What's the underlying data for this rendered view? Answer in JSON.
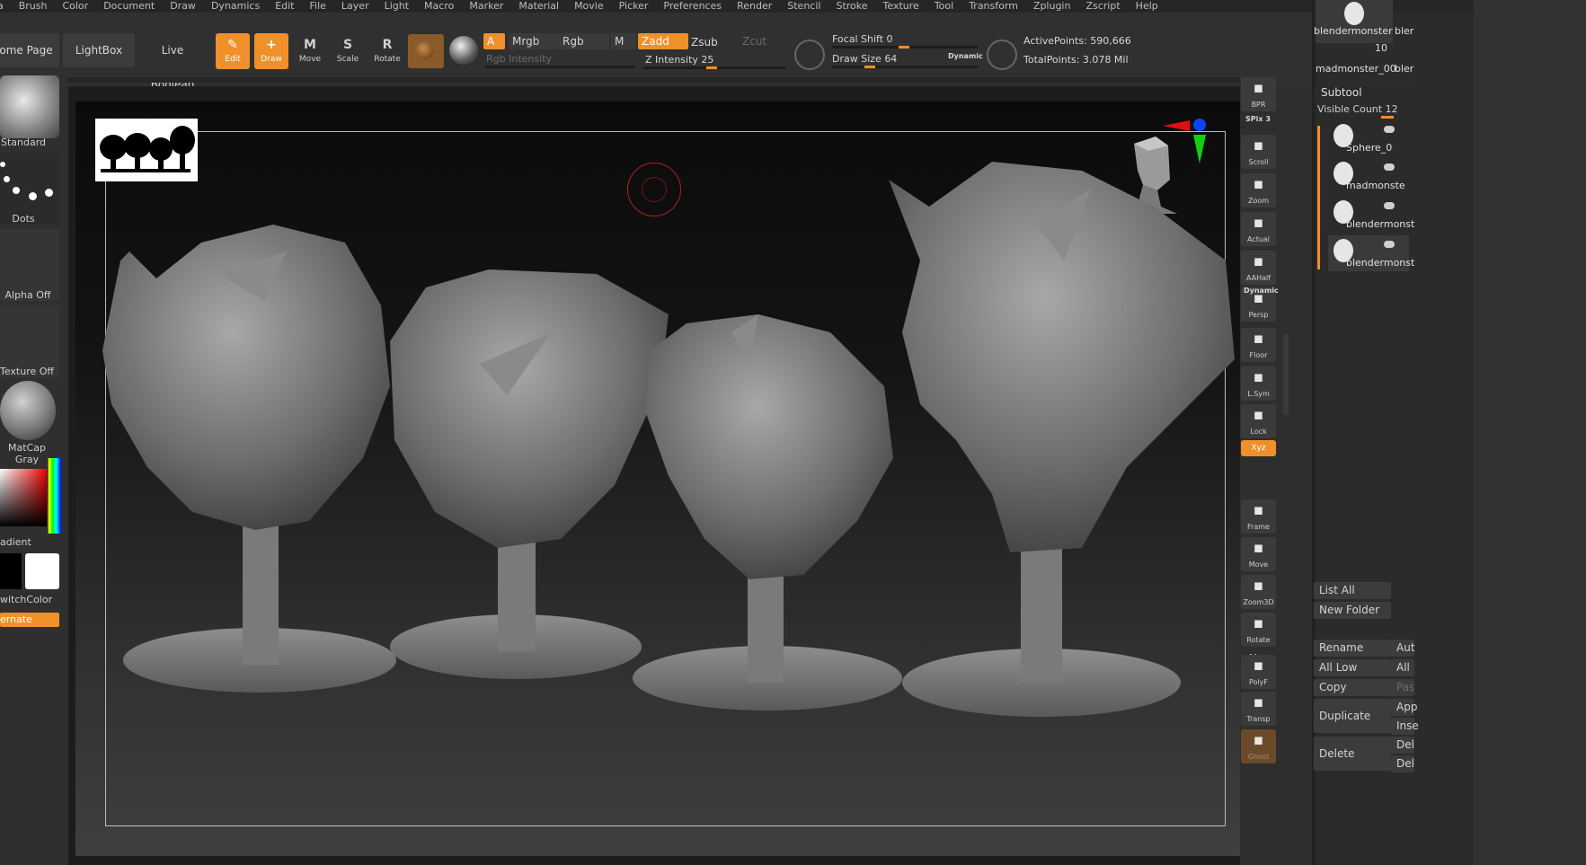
{
  "menu": [
    "ha",
    "Brush",
    "Color",
    "Document",
    "Draw",
    "Dynamics",
    "Edit",
    "File",
    "Layer",
    "Light",
    "Macro",
    "Marker",
    "Material",
    "Movie",
    "Picker",
    "Preferences",
    "Render",
    "Stencil",
    "Stroke",
    "Texture",
    "Tool",
    "Transform",
    "Zplugin",
    "Zscript",
    "Help"
  ],
  "toolbar": {
    "home_page": "ome Page",
    "lightbox": "LightBox",
    "live_boolean": "Live Boolean",
    "edit": "Edit",
    "draw": "Draw",
    "move": "Move",
    "scale": "Scale",
    "rotate": "Rotate",
    "a_chip": "A",
    "mrgb": "Mrgb",
    "rgb": "Rgb",
    "m": "M",
    "zadd": "Zadd",
    "zsub": "Zsub",
    "zcut": "Zcut",
    "rgb_intensity": "Rgb Intensity",
    "z_intensity_label": "Z Intensity",
    "z_intensity_value": "25",
    "focal_shift_label": "Focal Shift",
    "focal_shift_value": "0",
    "draw_size_label": "Draw Size",
    "draw_size_value": "64",
    "dynamic": "Dynamic",
    "active_points": "ActivePoints: 590,666",
    "total_points": "TotalPoints: 3.078 Mil"
  },
  "left_shelf": {
    "brush": "Standard",
    "stroke": "Dots",
    "alpha": "Alpha Off",
    "texture": "Texture Off",
    "material": "MatCap Gray",
    "gradient": "adient",
    "switch_color": "witchColor",
    "alternate": "ernate"
  },
  "right_shelf": [
    {
      "label": "BPR",
      "icon": "bpr-sphere-icon"
    },
    {
      "label": "SPix 3",
      "icon": ""
    },
    {
      "label": "Scroll",
      "icon": "scroll-icon"
    },
    {
      "label": "Zoom",
      "icon": "zoom-icon"
    },
    {
      "label": "Actual",
      "icon": "actual-icon"
    },
    {
      "label": "AAHalf",
      "icon": "aahalf-icon"
    },
    {
      "label": "Persp",
      "icon": "persp-icon"
    },
    {
      "label": "Dynamic",
      "icon": ""
    },
    {
      "label": "Floor",
      "icon": "floor-icon"
    },
    {
      "label": "L.Sym",
      "icon": "lsym-icon"
    },
    {
      "label": "Lock",
      "icon": "lock-icon"
    },
    {
      "label": "Xyz",
      "icon": "xyz-icon"
    },
    {
      "label": "Frame",
      "icon": "frame-icon"
    },
    {
      "label": "Move",
      "icon": "move-hand-icon"
    },
    {
      "label": "Zoom3D",
      "icon": "zoom3d-icon"
    },
    {
      "label": "Rotate",
      "icon": "rotate-icon"
    },
    {
      "label": "Line Fill",
      "icon": ""
    },
    {
      "label": "PolyF",
      "icon": "polyf-icon"
    },
    {
      "label": "Transp",
      "icon": "transp-icon"
    },
    {
      "label": "Ghost",
      "icon": "ghost-icon"
    }
  ],
  "right_panel": {
    "top_tool_1": "blendermonster",
    "top_tool_1b": "bler",
    "count": "10",
    "top_tool_2": "madmonster_00",
    "top_tool_2b": "bler",
    "subtool_title": "Subtool",
    "visible_count": "Visible Count 12",
    "subtools": [
      "",
      "Sphere_0",
      "madmonste",
      "blendermonst",
      "blendermonst"
    ],
    "list_all": "List All",
    "new_folder": "New Folder",
    "rename": "Rename",
    "auto": "Aut",
    "all_low": "All Low",
    "all_high": "All",
    "copy": "Copy",
    "paste": "Pas",
    "duplicate": "Duplicate",
    "append": "App",
    "insert": "Inse",
    "delete": "Delete",
    "del1": "Del",
    "del2": "Del"
  },
  "colors": {
    "accent": "#f0902a",
    "bg": "#2b2b2b",
    "panel": "#323232"
  }
}
